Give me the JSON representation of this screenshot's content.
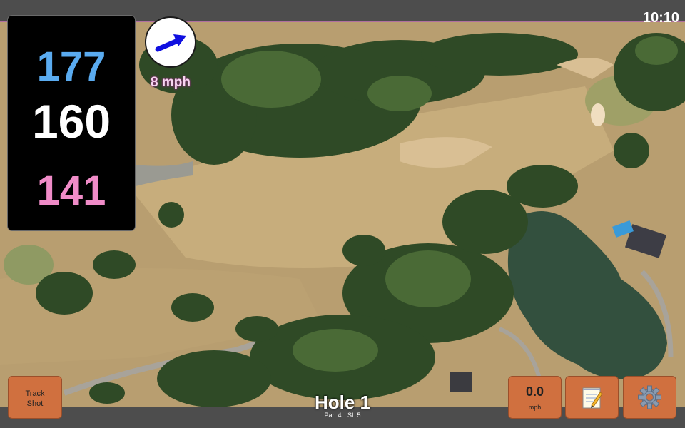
{
  "status": {
    "time": "10:10"
  },
  "distances": {
    "back": "177",
    "middle": "160",
    "front": "141"
  },
  "wind": {
    "speed": "8 mph",
    "icon": "wind-direction-arrow-icon"
  },
  "hole": {
    "title": "Hole 1",
    "par": "Par: 4",
    "stroke_index": "SI: 5"
  },
  "buttons": {
    "track_shot": [
      "Track",
      "Shot"
    ],
    "speed_value": "0.0",
    "speed_unit": "mph",
    "notes_icon": "notepad-icon",
    "settings_icon": "gear-icon"
  },
  "colors": {
    "back": "#5aabf0",
    "middle": "#ffffff",
    "front": "#f08cc8",
    "button": "#d0703f",
    "wind_text": "#f7d6f0"
  }
}
